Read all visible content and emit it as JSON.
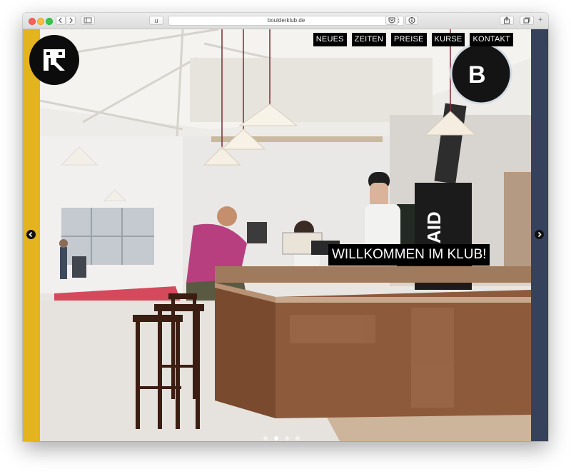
{
  "browser": {
    "url": "boulderklub.de",
    "reader_label": "u"
  },
  "site": {
    "nav": [
      {
        "label": "NEUES"
      },
      {
        "label": "ZEITEN"
      },
      {
        "label": "PREISE"
      },
      {
        "label": "KURSE"
      },
      {
        "label": "KONTAKT"
      }
    ],
    "hero_headline": "WILLKOMMEN IM KLUB!",
    "slider": {
      "slide_count": 4,
      "active_slide": 2
    },
    "colors": {
      "left_stripe": "#e4b41f",
      "right_stripe": "#36425c",
      "nav_background": "#000000"
    },
    "icons": {
      "logo": "bk-logo",
      "prev": "chevron-left-icon",
      "next": "chevron-right-icon"
    }
  }
}
